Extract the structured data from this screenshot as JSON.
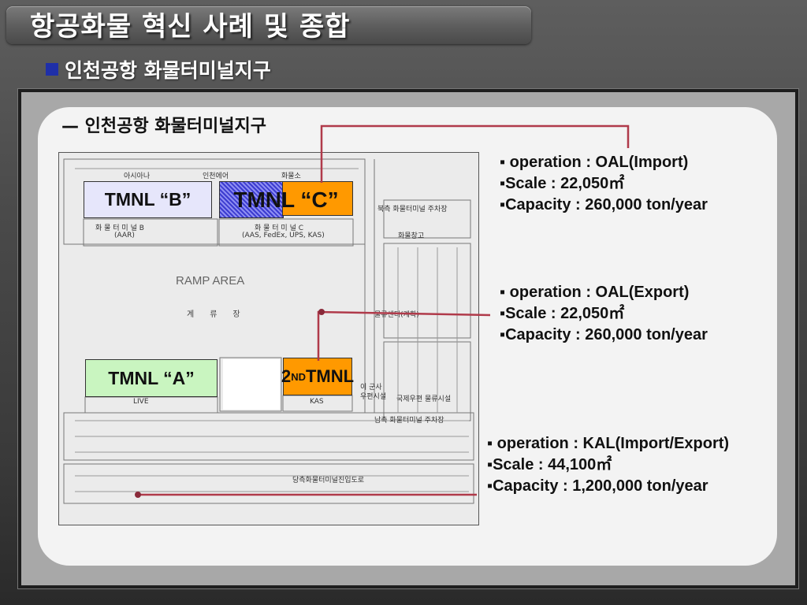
{
  "slide": {
    "title": "항공화물 혁신 사례 및 종합",
    "subtitle": "인천공항 화물터미널지구"
  },
  "panel": {
    "heading": "— 인천공항 화물터미널지구"
  },
  "map": {
    "terminals": {
      "b": "TMNL “B”",
      "c": "TMNL “C”",
      "a": "TMNL “A”",
      "second_prefix": "2",
      "second_sup": "ND",
      "second_suffix": " TMNL"
    },
    "labels": {
      "asiana": "아시아나",
      "incheon_air": "인천에어",
      "hwamulso": "화물소",
      "hwamul_b": "화 물 터 미 널 B",
      "hwamul_b_sub": "(AAR)",
      "hwamul_c": "화 물 터 미 널 C",
      "hwamul_c_sub": "(AAS, FedEx, UPS, KAS)",
      "parking": "북측 화물터미널 주차장",
      "warehouse": "화물창고",
      "ramp": "RAMP AREA",
      "gyeryu": "계류장",
      "center": "물류센터(계획)",
      "kas": "KAS",
      "live": "LIVE",
      "icheon": "이 군사",
      "udeon": "우편시설",
      "intl": "국제우편 물류시설",
      "south_parking": "남측 화물터미널 주차장",
      "gongyang": "당측화물터미널진입도로"
    },
    "info_blocks": [
      {
        "op": "▪ operation : OAL(Import)",
        "scale": "▪Scale : 22,050㎡",
        "cap": "▪Capacity : 260,000 ton/year"
      },
      {
        "op": "▪ operation : OAL(Export)",
        "scale": "▪Scale : 22,050㎡",
        "cap": "▪Capacity : 260,000 ton/year"
      },
      {
        "op": "▪ operation : KAL(Import/Export)",
        "scale": "▪Scale : 44,100㎡",
        "cap": "▪Capacity : 1,200,000 ton/year"
      }
    ],
    "colors": {
      "accent_line": "#b03a4a",
      "orange": "#ff9900",
      "tmnl_b": "#e6e6fb",
      "tmnl_a": "#c9f5c0"
    }
  }
}
